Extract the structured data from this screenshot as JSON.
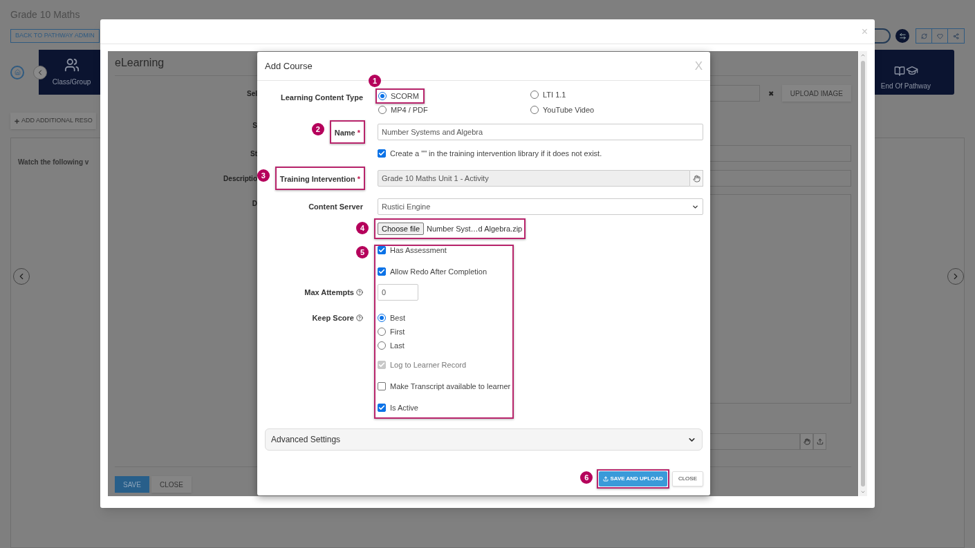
{
  "page": {
    "title": "Grade 10 Maths",
    "back_button": "BACK TO PATHWAY ADMIN",
    "tiles": [
      {
        "label": "Class/Group"
      },
      {
        "label": "End Of Pathway"
      }
    ],
    "add_button": "ADD ADDITIONAL RESO",
    "card_text": "Watch the following v"
  },
  "outer_modal": {
    "close": "×",
    "panel_title": "eLearning",
    "labels": [
      "Sel",
      "S",
      "St",
      "Descriptio",
      "D"
    ],
    "upload_button": "UPLOAD IMAGE",
    "clear": "✖",
    "save_button": "SAVE",
    "close_button": "CLOSE"
  },
  "dialog": {
    "title": "Add Course",
    "close": "X",
    "content_type": {
      "label": "Learning Content Type",
      "options": [
        {
          "label": "SCORM",
          "selected": true,
          "badge": "1"
        },
        {
          "label": "LTI 1.1",
          "selected": false
        },
        {
          "label": "MP4 / PDF",
          "selected": false
        },
        {
          "label": "YouTube Video",
          "selected": false
        }
      ]
    },
    "name": {
      "label": "Name",
      "required_mark": "*",
      "value": "Number Systems and Algebra",
      "badge": "2"
    },
    "create_checkbox": {
      "label": "Create a \"\" in the training intervention library if it does not exist.",
      "checked": true
    },
    "training_intervention": {
      "label": "Training Intervention",
      "required_mark": "*",
      "value": "Grade 10 Maths Unit 1 - Activity",
      "badge": "3"
    },
    "content_server": {
      "label": "Content Server",
      "value": "Rustici Engine"
    },
    "file": {
      "button": "Choose file",
      "filename": "Number Syst…d Algebra.zip",
      "badge": "4"
    },
    "assessment": {
      "badge": "5",
      "rows": [
        {
          "kind": "checkbox",
          "label": "Has Assessment",
          "checked": true,
          "disabled": false
        },
        {
          "kind": "checkbox",
          "label": "Allow Redo After Completion",
          "checked": true,
          "disabled": false
        },
        {
          "kind": "number",
          "label": "Max Attempts",
          "value": "0"
        },
        {
          "kind": "radio",
          "label": "Keep Score",
          "options": [
            {
              "label": "Best",
              "selected": true
            },
            {
              "label": "First",
              "selected": false
            },
            {
              "label": "Last",
              "selected": false
            }
          ]
        },
        {
          "kind": "checkbox",
          "label": "Log to Learner Record",
          "checked": true,
          "disabled": true
        },
        {
          "kind": "checkbox",
          "label": "Make Transcript available to learner",
          "checked": false,
          "disabled": false
        },
        {
          "kind": "checkbox",
          "label": "Is Active",
          "checked": true,
          "disabled": false
        }
      ]
    },
    "advanced": {
      "label": "Advanced Settings",
      "expanded": false
    },
    "save_button": {
      "label": "SAVE AND UPLOAD",
      "badge": "6"
    },
    "close_button": "CLOSE"
  }
}
